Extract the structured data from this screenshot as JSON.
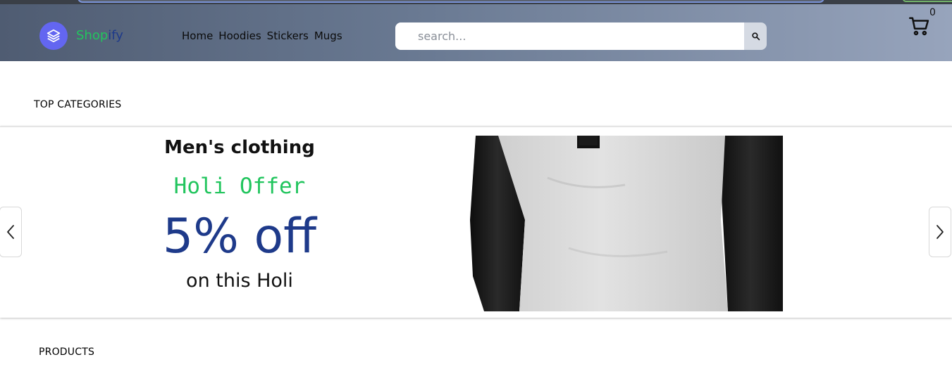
{
  "brand": {
    "name_part1": "Shop",
    "name_part2": "ify",
    "logo_icon": "layers-icon"
  },
  "nav": {
    "items": [
      "Home",
      "Hoodies",
      "Stickers",
      "Mugs"
    ]
  },
  "search": {
    "placeholder": "search...",
    "value": "",
    "button_icon": "search-icon"
  },
  "cart": {
    "icon": "cart-icon",
    "count": "0"
  },
  "sections": {
    "top_categories": "TOP CATEGORIES",
    "products": "PRODUCTS"
  },
  "carousel": {
    "slide": {
      "title": "Men's clothing",
      "offer": "Holi Offer",
      "discount": "5% off",
      "subtitle": "on this Holi",
      "image_icon": "shirt-image"
    },
    "prev_icon": "chevron-left-icon",
    "next_icon": "chevron-right-icon"
  },
  "colors": {
    "accent_green": "#22c55e",
    "accent_blue": "#1e3a8a",
    "logo_bg": "#6366f1",
    "header_gradient_start": "#4f5c72",
    "header_gradient_end": "#97a4bc"
  }
}
